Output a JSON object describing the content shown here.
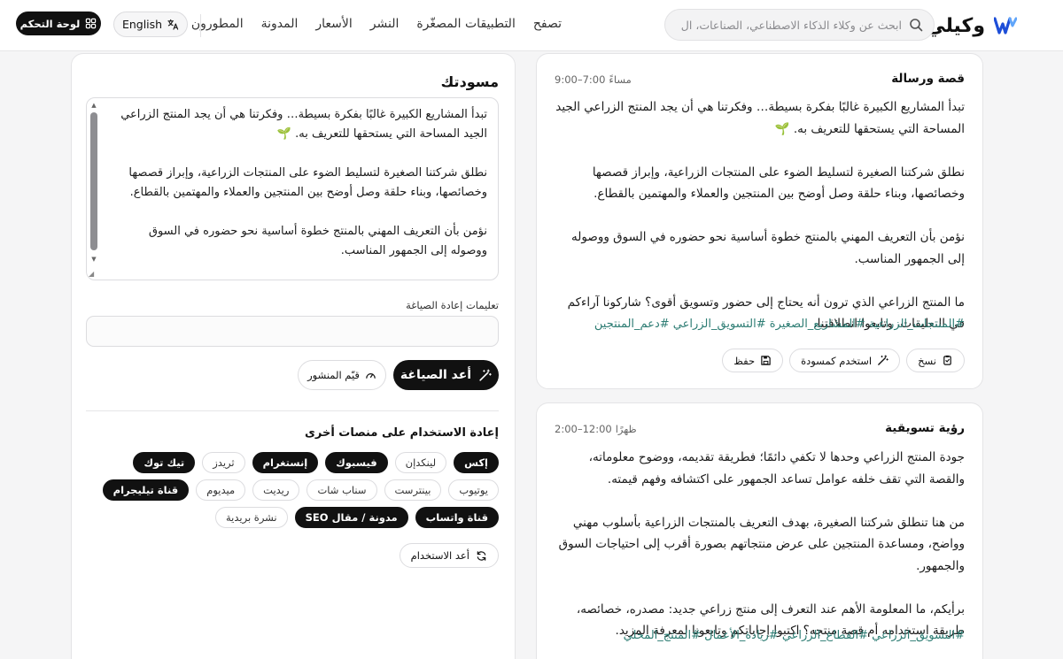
{
  "header": {
    "brand": "وكيلي",
    "search_placeholder": "ابحث عن وكلاء الذكاء الاصطناعي، الصناعات، ال",
    "nav": [
      "تصفح",
      "التطبيقات المصغّرة",
      "النشر",
      "الأسعار",
      "المدونة",
      "المطورون"
    ],
    "language": "English",
    "dashboard": "لوحة التحكم"
  },
  "cards": [
    {
      "title": "قصة ورسالة",
      "time_range": "9:00–7:00",
      "time_label": "مساءً",
      "body": "تبدأ المشاريع الكبيرة غالبًا بفكرة بسيطة… وفكرتنا هي أن يجد المنتج الزراعي الجيد المساحة التي يستحقها للتعريف به. 🌱\n\nنطلق شركتنا الصغيرة لتسليط الضوء على المنتجات الزراعية، وإبراز قصصها وخصائصها، وبناء حلقة وصل أوضح بين المنتجين والعملاء والمهتمين بالقطاع.\n\nنؤمن بأن التعريف المهني بالمنتج خطوة أساسية نحو حضوره في السوق ووصوله إلى الجمهور المناسب.\n\nما المنتج الزراعي الذي ترون أنه يحتاج إلى حضور وتسويق أقوى؟ شاركونا آراءكم في التعليقات، وتابعوا انطلاقتنا.",
      "hashtags": "#المنتجات_الزراعية #المشاريع_الصغيرة #التسويق_الزراعي #دعم_المنتجين",
      "actions": {
        "copy": "نسخ",
        "use_draft": "استخدم كمسودة",
        "save": "حفظ"
      }
    },
    {
      "title": "رؤية تسويقية",
      "time_range": "2:00–12:00",
      "time_label": "ظهرًا",
      "body": "جودة المنتج الزراعي وحدها لا تكفي دائمًا؛ فطريقة تقديمه، ووضوح معلوماته، والقصة التي تقف خلفه عوامل تساعد الجمهور على اكتشافه وفهم قيمته.\n\nمن هنا تنطلق شركتنا الصغيرة، بهدف التعريف بالمنتجات الزراعية بأسلوب مهني وواضح، ومساعدة المنتجين على عرض منتجاتهم بصورة أقرب إلى احتياجات السوق والجمهور.\n\nبرأيكم، ما المعلومة الأهم عند التعرف إلى منتج زراعي جديد: مصدره، خصائصه، طريقة استخدامه أم قصة منتجه؟ اكتبوا إجاباتكم وتابعونا لمعرفة المزيد.",
      "hashtags": "#التسويق_الزراعي #القطاع_الزراعي #ريادة_الأعمال #المنتج_المحلي"
    }
  ],
  "draft": {
    "title": "مسودتك",
    "text": "تبدأ المشاريع الكبيرة غالبًا بفكرة بسيطة… وفكرتنا هي أن يجد المنتج الزراعي الجيد المساحة التي يستحقها للتعريف به. 🌱\n\nنطلق شركتنا الصغيرة لتسليط الضوء على المنتجات الزراعية، وإبراز قصصها وخصائصها، وبناء حلقة وصل أوضح بين المنتجين والعملاء والمهتمين بالقطاع.\n\nنؤمن بأن التعريف المهني بالمنتج خطوة أساسية نحو حضوره في السوق ووصوله إلى الجمهور المناسب.\n\nما المنتج الزراعي الذي ترون أنه يحتاج إلى حضور وتسويق أقوى؟ شاركونا آراءكم في التعليقات، وتابعوا انطلاقتنا.",
    "rephrase_label": "تعليمات إعادة الصياغة",
    "rephrase_value": "",
    "rephrase_button": "أعد الصياغة",
    "evaluate_button": "قيّم المنشور",
    "reuse_title": "إعادة الاستخدام على منصات أخرى",
    "platforms": [
      {
        "label": "إكس",
        "active": true
      },
      {
        "label": "لينكدإن",
        "active": false
      },
      {
        "label": "فيسبوك",
        "active": true
      },
      {
        "label": "إنستغرام",
        "active": true
      },
      {
        "label": "ثريدز",
        "active": false
      },
      {
        "label": "تيك توك",
        "active": true
      },
      {
        "label": "يوتيوب",
        "active": false
      },
      {
        "label": "بينترست",
        "active": false
      },
      {
        "label": "سناب شات",
        "active": false
      },
      {
        "label": "ريديت",
        "active": false
      },
      {
        "label": "ميديوم",
        "active": false
      },
      {
        "label": "قناة تيليجرام",
        "active": true
      },
      {
        "label": "قناة واتساب",
        "active": true
      },
      {
        "label": "مدونة / مقال SEO",
        "active": true
      },
      {
        "label": "نشرة بريدية",
        "active": false
      }
    ],
    "reuse_button": "أعد الاستخدام"
  },
  "colors": {
    "accent": "#111111",
    "hashtag": "#2e7d74",
    "logo": "#1d4ed8"
  }
}
